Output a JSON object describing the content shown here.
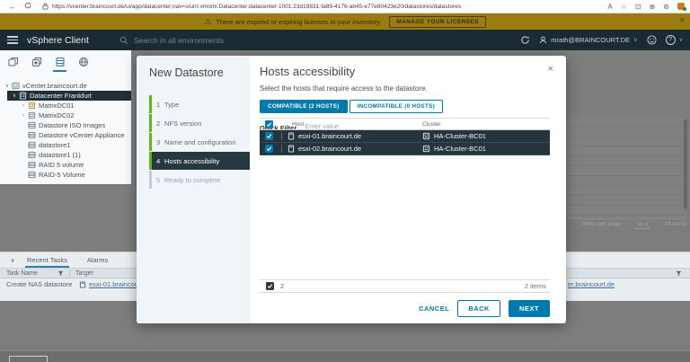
{
  "browser": {
    "url": "https://vcenter.braincourt.de/ui/app/datacenter;nav=s/urn:vmomi:Datacenter:datacenter-1001:23d19831-fa89-4176-ab45-e77e80423e20/datastores/datastores",
    "url_host": "vcenter.braincourt.de"
  },
  "icons": {
    "back": "←",
    "close_x": "×",
    "warning": "⚠",
    "chev_down": "∨",
    "chev_right": "›",
    "help": "?",
    "action_font": "A",
    "action_fav": "☆",
    "action_split": "⊡",
    "action_collections": "⊕",
    "action_essentials": "⊚"
  },
  "banner": {
    "message": "There are expired or expiring licenses in your inventory.",
    "button": "MANAGE YOUR LICENSES"
  },
  "header": {
    "app_title": "vSphere Client",
    "search_placeholder": "Search in all environments",
    "user": "mrath@BRAINCOURT.DE"
  },
  "sidebar": {
    "tree": [
      {
        "label": "vCenter.braincourt.de",
        "exp": "∨"
      },
      {
        "label": "Datacenter Frankfurt",
        "exp": "∨"
      },
      {
        "label": "MatrixDC01",
        "exp": "›"
      },
      {
        "label": "MatrixDC02",
        "exp": "›"
      },
      {
        "label": "Datastore ISO Images",
        "exp": ""
      },
      {
        "label": "Datastore vCenter Appliance",
        "exp": ""
      },
      {
        "label": "datastore1",
        "exp": ""
      },
      {
        "label": "datastore1 (1)",
        "exp": ""
      },
      {
        "label": "RAID 5 volume",
        "exp": ""
      },
      {
        "label": "RAID-5 Volume",
        "exp": ""
      }
    ]
  },
  "background": {
    "items_per_page_label": "Items per page",
    "items_per_page_value": "35",
    "items_per_page_chevron": "∨",
    "items_total": "14 items"
  },
  "tasks_panel": {
    "tabs": [
      {
        "label": "Recent Tasks"
      },
      {
        "label": "Alarms"
      }
    ],
    "columns": {
      "task": "Task Name",
      "target": "Target"
    },
    "rows": [
      {
        "task": "Create NAS datastore",
        "target": "esxi-01.braincourt.de",
        "target_fragment": "er.braincourt.de"
      }
    ]
  },
  "wizard": {
    "title": "New Datastore",
    "steps": [
      {
        "num": "1",
        "label": "Type"
      },
      {
        "num": "2",
        "label": "NFS version"
      },
      {
        "num": "3",
        "label": "Name and configuration"
      },
      {
        "num": "4",
        "label": "Hosts accessibility"
      },
      {
        "num": "5",
        "label": "Ready to complete"
      }
    ],
    "page": {
      "title": "Hosts accessibility",
      "subtitle": "Select the hosts that require access to the datastore.",
      "tab_compatible": "COMPATIBLE (2 HOSTS)",
      "tab_incompatible": "INCOMPATIBLE (0 HOSTS)",
      "filter_label": "Quick Filter",
      "filter_placeholder": "Enter value",
      "table": {
        "col_host": "Host",
        "col_cluster": "Cluster",
        "rows": [
          {
            "host": "esxi-01.braincourt.de",
            "cluster": "HA-Cluster-BC01"
          },
          {
            "host": "esxi-02.braincourt.de",
            "cluster": "HA-Cluster-BC01"
          }
        ],
        "selected_count": "2",
        "items_total": "2 items"
      },
      "buttons": {
        "cancel": "CANCEL",
        "back": "BACK",
        "next": "NEXT"
      }
    }
  }
}
